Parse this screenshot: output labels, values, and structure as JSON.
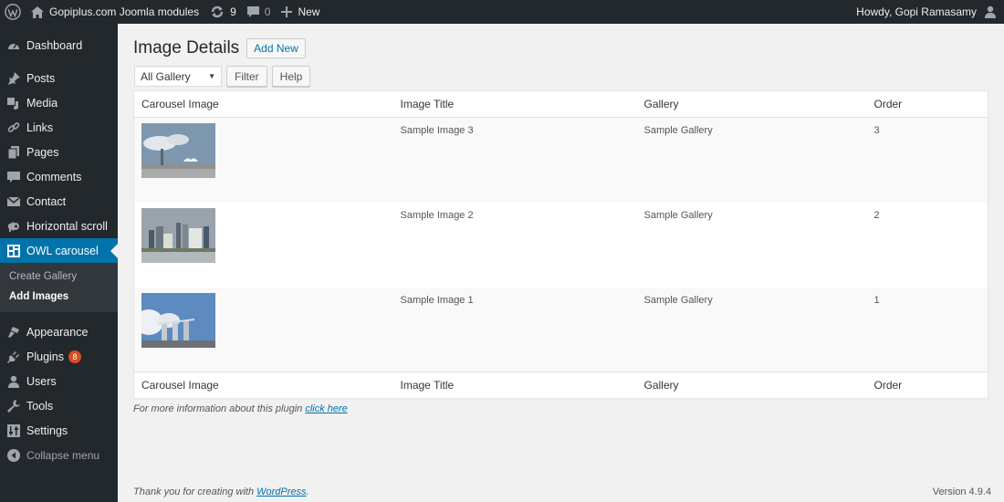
{
  "adminbar": {
    "site_name": "Gopiplus.com Joomla modules",
    "updates_count": "9",
    "comments_count": "0",
    "new_label": "New",
    "howdy": "Howdy, Gopi Ramasamy"
  },
  "sidebar": {
    "items": [
      {
        "label": "Dashboard",
        "icon": "dashboard-icon"
      },
      {
        "label": "Posts",
        "icon": "pin-icon"
      },
      {
        "label": "Media",
        "icon": "media-icon"
      },
      {
        "label": "Links",
        "icon": "link-icon"
      },
      {
        "label": "Pages",
        "icon": "pages-icon"
      },
      {
        "label": "Comments",
        "icon": "comment-icon"
      },
      {
        "label": "Contact",
        "icon": "envelope-icon"
      },
      {
        "label": "Horizontal scroll",
        "icon": "megaphone-icon"
      },
      {
        "label": "OWL carousel",
        "icon": "layout-icon"
      },
      {
        "label": "Appearance",
        "icon": "brush-icon"
      },
      {
        "label": "Plugins",
        "icon": "plug-icon",
        "badge": "8"
      },
      {
        "label": "Users",
        "icon": "user-icon"
      },
      {
        "label": "Tools",
        "icon": "wrench-icon"
      },
      {
        "label": "Settings",
        "icon": "sliders-icon"
      }
    ],
    "submenu": [
      {
        "label": "Create Gallery"
      },
      {
        "label": "Add Images"
      }
    ],
    "collapse_label": "Collapse menu"
  },
  "main": {
    "title": "Image Details",
    "add_new_label": "Add New",
    "filter_select_value": "All Gallery",
    "filter_button": "Filter",
    "help_button": "Help",
    "table": {
      "columns": [
        "Carousel Image",
        "Image Title",
        "Gallery",
        "Order"
      ],
      "rows": [
        {
          "thumb": "Marina Bay ArtScience Museum photo",
          "title": "Sample Image 3",
          "gallery": "Sample Gallery",
          "order": "3"
        },
        {
          "thumb": "Singapore skyline photo",
          "title": "Sample Image 2",
          "gallery": "Sample Gallery",
          "order": "2"
        },
        {
          "thumb": "Marina Bay Sands photo",
          "title": "Sample Image 1",
          "gallery": "Sample Gallery",
          "order": "1"
        }
      ]
    },
    "info_text": "For more information about this plugin ",
    "info_link": "click here"
  },
  "footer": {
    "thanks_text": "Thank you for creating with ",
    "thanks_link": "WordPress",
    "thanks_suffix": ".",
    "version": "Version 4.9.4"
  },
  "colors": {
    "adminbar_bg": "#23282d",
    "active_menu": "#0073aa",
    "badge": "#d54e21",
    "link": "#0073aa"
  }
}
